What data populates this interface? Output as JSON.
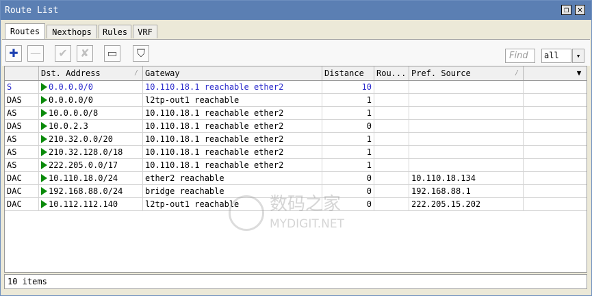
{
  "window": {
    "title": "Route List",
    "maximize_glyph": "❐",
    "close_glyph": "✕"
  },
  "tabs": [
    {
      "label": "Routes",
      "active": true
    },
    {
      "label": "Nexthops",
      "active": false
    },
    {
      "label": "Rules",
      "active": false
    },
    {
      "label": "VRF",
      "active": false
    }
  ],
  "toolbar": {
    "add": "✚",
    "remove": "—",
    "enable": "✔",
    "disable": "✘",
    "comment": "▭",
    "filter": "⛉",
    "find_placeholder": "Find",
    "filter_select_value": "all",
    "filter_select_arrow": "▾"
  },
  "table": {
    "columns": [
      {
        "label": "",
        "sort": ""
      },
      {
        "label": "Dst. Address",
        "sort": "/"
      },
      {
        "label": "Gateway",
        "sort": ""
      },
      {
        "label": "Distance",
        "sort": ""
      },
      {
        "label": "Rou...",
        "sort": ""
      },
      {
        "label": "Pref. Source",
        "sort": "/"
      },
      {
        "label": "",
        "sort": ""
      }
    ],
    "menu_glyph": "▼",
    "rows": [
      {
        "flags": "S",
        "dst": "0.0.0.0/0",
        "gateway": "10.110.18.1 reachable ether2",
        "distance": "10",
        "routing": "",
        "pref_source": "",
        "static": true
      },
      {
        "flags": "DAS",
        "dst": "0.0.0.0/0",
        "gateway": "l2tp-out1 reachable",
        "distance": "1",
        "routing": "",
        "pref_source": "",
        "static": false
      },
      {
        "flags": "AS",
        "dst": "10.0.0.0/8",
        "gateway": "10.110.18.1 reachable ether2",
        "distance": "1",
        "routing": "",
        "pref_source": "",
        "static": false
      },
      {
        "flags": "DAS",
        "dst": "10.0.2.3",
        "gateway": "10.110.18.1 reachable ether2",
        "distance": "0",
        "routing": "",
        "pref_source": "",
        "static": false
      },
      {
        "flags": "AS",
        "dst": "210.32.0.0/20",
        "gateway": "10.110.18.1 reachable ether2",
        "distance": "1",
        "routing": "",
        "pref_source": "",
        "static": false
      },
      {
        "flags": "AS",
        "dst": "210.32.128.0/18",
        "gateway": "10.110.18.1 reachable ether2",
        "distance": "1",
        "routing": "",
        "pref_source": "",
        "static": false
      },
      {
        "flags": "AS",
        "dst": "222.205.0.0/17",
        "gateway": "10.110.18.1 reachable ether2",
        "distance": "1",
        "routing": "",
        "pref_source": "",
        "static": false
      },
      {
        "flags": "DAC",
        "dst": "10.110.18.0/24",
        "gateway": "ether2 reachable",
        "distance": "0",
        "routing": "",
        "pref_source": "10.110.18.134",
        "static": false
      },
      {
        "flags": "DAC",
        "dst": "192.168.88.0/24",
        "gateway": "bridge reachable",
        "distance": "0",
        "routing": "",
        "pref_source": "192.168.88.1",
        "static": false
      },
      {
        "flags": "DAC",
        "dst": "10.112.112.140",
        "gateway": "l2tp-out1 reachable",
        "distance": "0",
        "routing": "",
        "pref_source": "222.205.15.202",
        "static": false
      }
    ]
  },
  "status": {
    "text": "10 items"
  },
  "watermark": {
    "cn": "数码之家",
    "en": "MYDIGIT.NET"
  }
}
